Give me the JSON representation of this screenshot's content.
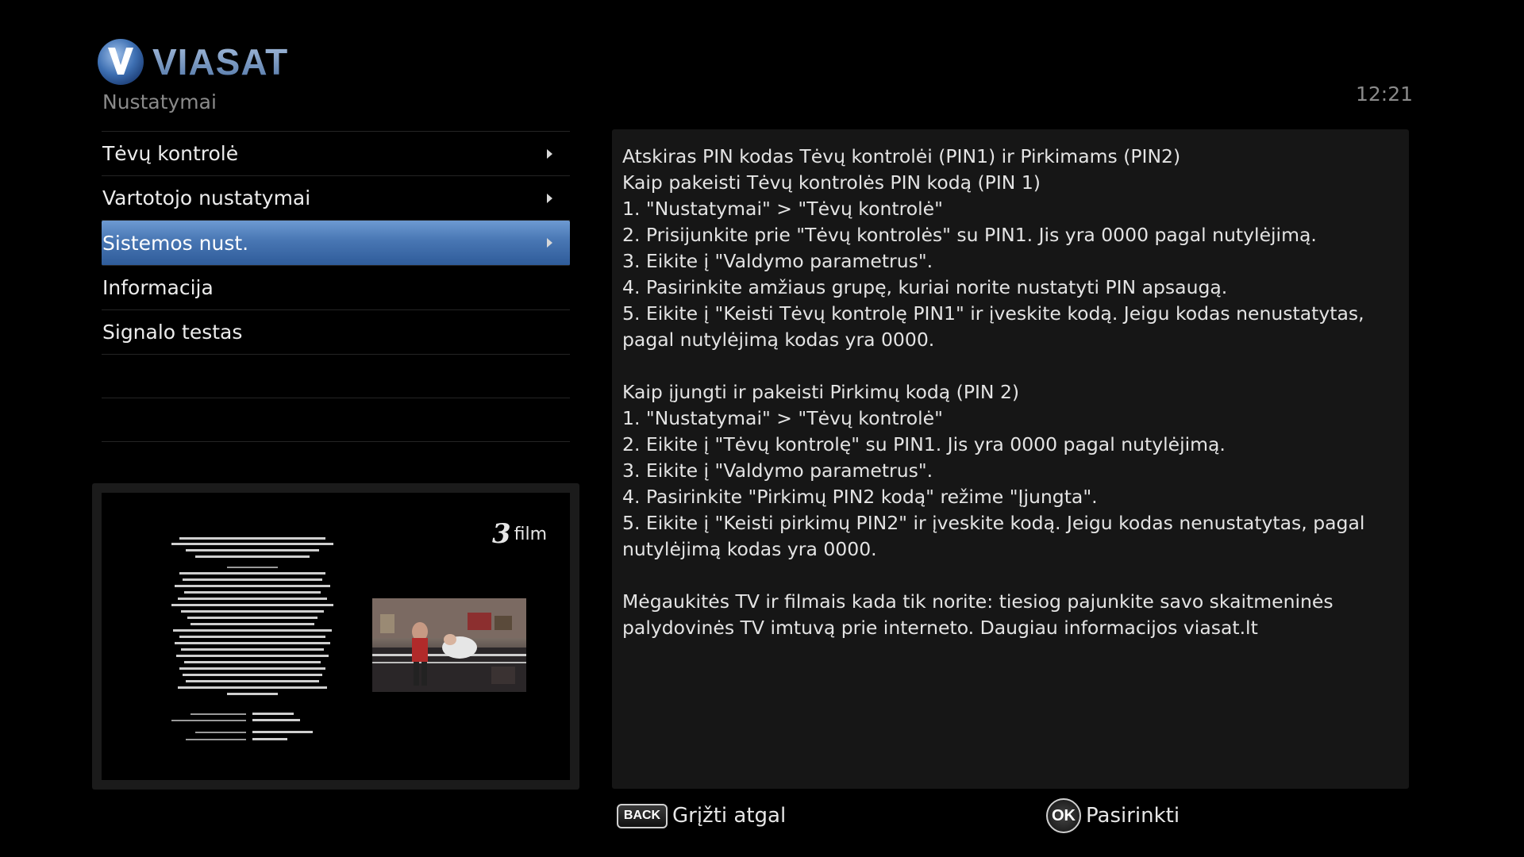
{
  "header": {
    "brand": "VIASAT",
    "section_title": "Nustatymai",
    "clock": "12:21"
  },
  "menu": {
    "items": [
      {
        "label": "Tėvų kontrolė",
        "has_submenu": true
      },
      {
        "label": "Vartotojo nustatymai",
        "has_submenu": true
      },
      {
        "label": "Sistemos nust.",
        "has_submenu": true,
        "selected": true
      },
      {
        "label": "Informacija",
        "has_submenu": false
      },
      {
        "label": "Signalo testas",
        "has_submenu": false
      }
    ]
  },
  "preview": {
    "channel_number": "3",
    "channel_word": "film"
  },
  "info": {
    "text": "Atskiras PIN kodas Tėvų kontrolėi (PIN1) ir Pirkimams (PIN2)\nKaip pakeisti Tėvų kontrolės PIN kodą (PIN 1)\n1. \"Nustatymai\" > \"Tėvų kontrolė\"\n2. Prisijunkite prie \"Tėvų kontrolės\" su PIN1. Jis yra 0000 pagal nutylėjimą.\n3. Eikite į \"Valdymo parametrus\".\n4. Pasirinkite amžiaus grupę, kuriai norite nustatyti PIN apsaugą.\n5. Eikite į \"Keisti Tėvų kontrolę PIN1\" ir įveskite kodą.  Jeigu kodas nenustatytas, pagal nutylėjimą kodas yra 0000.\n\nKaip įjungti ir pakeisti Pirkimų kodą (PIN 2)\n1. \"Nustatymai\" > \"Tėvų kontrolė\"\n2. Eikite į \"Tėvų kontrolę\" su PIN1. Jis yra 0000 pagal nutylėjimą.\n3. Eikite į \"Valdymo parametrus\".\n4. Pasirinkite \"Pirkimų PIN2 kodą\" režime \"Įjungta\".\n5. Eikite į \"Keisti pirkimų PIN2\" ir įveskite kodą. Jeigu kodas nenustatytas, pagal nutylėjimą kodas yra 0000.\n\nMėgaukitės TV ir filmais kada tik norite: tiesiog pajunkite savo skaitmeninės palydovinės TV imtuvą prie interneto. Daugiau informacijos  viasat.lt"
  },
  "footer": {
    "back_key": "BACK",
    "back_label": "Grįžti atgal",
    "ok_key": "OK",
    "ok_label": "Pasirinkti"
  },
  "colors": {
    "background": "#000000",
    "selected_item": "#4876b3",
    "panel": "#161616",
    "muted_text": "#8a8a8a"
  }
}
